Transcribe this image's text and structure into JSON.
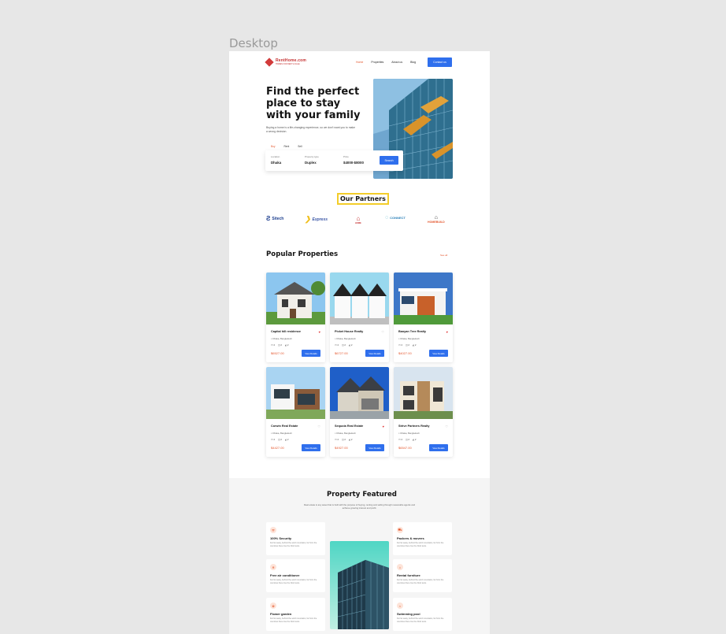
{
  "canvas": {
    "frame_label": "Desktop"
  },
  "nav": {
    "logo_text": "RentHome.com",
    "logo_sub": "HOMES FOR RENT & SALE",
    "links": [
      "Home",
      "Properties",
      "About us",
      "Blog"
    ],
    "contact_label": "Contact us"
  },
  "hero": {
    "title": "Find the perfect place to stay with your family",
    "subtitle": "Buying a home is a life-changing experience, so we don't want you to make a wrong decision.",
    "tabs": [
      "Buy",
      "Rent",
      "Sell"
    ],
    "fields": [
      {
        "label": "Location",
        "value": "Dhaka"
      },
      {
        "label": "Property type",
        "value": "Duplex"
      },
      {
        "label": "Price",
        "value": "$4000-$8000"
      }
    ],
    "search_label": "Search"
  },
  "partners": {
    "title": "Our Partners",
    "items": [
      "Sitech",
      "Express",
      "HOME",
      "CONNECT",
      "HOMEBUILD"
    ]
  },
  "popular": {
    "title": "Popular Properties",
    "see_all": "See all",
    "cards": [
      {
        "title": "Capital hill residence",
        "location": "Dhaka, Bangladesh",
        "beds": "4",
        "baths": "2",
        "area": "2",
        "price": "$6527.00",
        "button": "View Details",
        "liked": true
      },
      {
        "title": "Picket House Realty",
        "location": "Dhaka, Bangladesh",
        "beds": "4",
        "baths": "2",
        "area": "2",
        "price": "$6727.00",
        "button": "View Details",
        "liked": false
      },
      {
        "title": "Banyan Tree Realty",
        "location": "Dhaka, Bangladesh",
        "beds": "4",
        "baths": "2",
        "area": "2",
        "price": "$4027.00",
        "button": "View Details",
        "liked": true
      },
      {
        "title": "Corwin Real Estate",
        "location": "Dhaka, Bangladesh",
        "beds": "4",
        "baths": "2",
        "area": "2",
        "price": "$4427.00",
        "button": "View Details",
        "liked": false
      },
      {
        "title": "Sequoia Real Estate",
        "location": "Dhaka, Bangladesh",
        "beds": "4",
        "baths": "2",
        "area": "2",
        "price": "$4927.00",
        "button": "View Details",
        "liked": true
      },
      {
        "title": "Strive Partners Realty",
        "location": "Dhaka, Bangladesh",
        "beds": "4",
        "baths": "2",
        "area": "2",
        "price": "$6547.00",
        "button": "View Details",
        "liked": false
      }
    ]
  },
  "featured": {
    "title": "Property Featured",
    "description": "Real estate is any asset that is built with the purpose of buying, renting and selling through reasonable agents and achieve growing interest and profit.",
    "items": [
      {
        "title": "100% Security",
        "desc": "Far far away, behind the word mountains, far from the countries there live the blind texts."
      },
      {
        "title": "Free air conditioner",
        "desc": "Far far away, behind the word mountains, far from the countries there live the blind texts."
      },
      {
        "title": "Flower garden",
        "desc": "Far far away, behind the word mountains, far from the countries there live the blind texts."
      },
      {
        "title": "Packers & movers",
        "desc": "Far far away, behind the word mountains, far from the countries there live the blind texts."
      },
      {
        "title": "Rental furniture",
        "desc": "Far far away, behind the word mountains, far from the countries there live the blind texts."
      },
      {
        "title": "Swimming pool",
        "desc": "Far far away, behind the word mountains, far from the countries there live the blind texts."
      }
    ]
  },
  "colors": {
    "accent": "#2f6fed",
    "highlight": "#e4572e",
    "partner_border": "#f3cd2a"
  }
}
